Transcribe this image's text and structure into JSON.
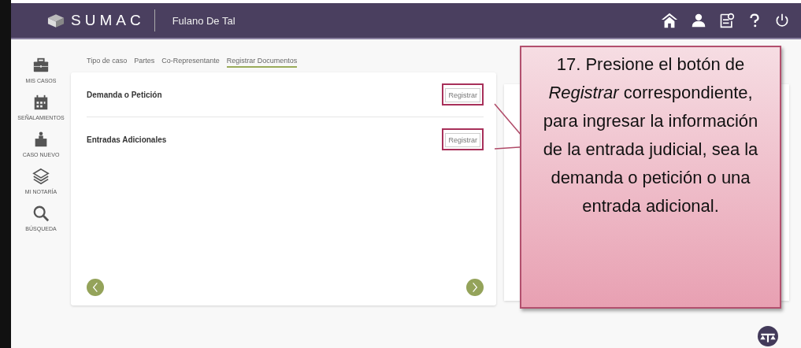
{
  "header": {
    "logo": "SUMAC",
    "user": "Fulano De Tal"
  },
  "sidebar": {
    "items": [
      {
        "label": "MIS CASOS"
      },
      {
        "label": "SEÑALAMIENTOS"
      },
      {
        "label": "CASO NUEVO"
      },
      {
        "label": "MI NOTARÍA"
      },
      {
        "label": "BÚSQUEDA"
      }
    ]
  },
  "tabs": [
    {
      "label": "Tipo de caso",
      "selected": false
    },
    {
      "label": "Partes",
      "selected": false
    },
    {
      "label": "Co-Representante",
      "selected": false
    },
    {
      "label": "Registrar Documentos",
      "selected": true
    }
  ],
  "sections": [
    {
      "title": "Demanda o Petición",
      "button": "Registrar",
      "highlighted": true
    },
    {
      "title": "Entradas Adicionales",
      "button": "Registrar",
      "highlighted": true
    }
  ],
  "callout": {
    "text": "17. Presione el botón de *Registrar* correspondiente, para ingresar la información de la entrada judicial, sea la demanda o petición o una entrada adicional."
  }
}
